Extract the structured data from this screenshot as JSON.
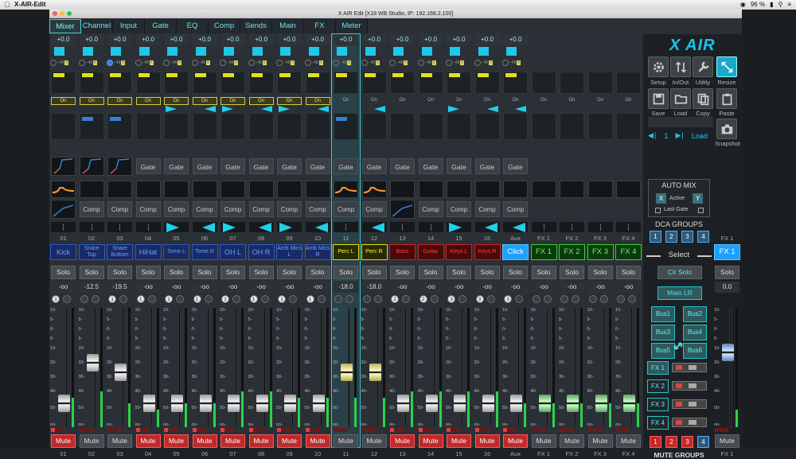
{
  "menubar": {
    "app": "X-AIR-Edit",
    "battery": "96 %"
  },
  "window": {
    "title": "X AIR Edit [X18 WB Studio, IP: 192.168.2.100]"
  },
  "tabs": [
    "Mixer",
    "Channel",
    "Input",
    "Gate",
    "EQ",
    "Comp",
    "Sends",
    "Main",
    "FX",
    "Meter"
  ],
  "strips": [
    {
      "num": "01",
      "name": "Kick",
      "gain": "+0.0",
      "db": "-oo",
      "dca": "1",
      "mute": true,
      "fader": 0.15,
      "level": 0.25,
      "style": "blue1",
      "pan": "",
      "gateOn": true,
      "compOn": true
    },
    {
      "num": "02",
      "name": "Snare Top",
      "gain": "+0.0",
      "db": "-12.5",
      "dca": "",
      "mute": false,
      "fader": 0.55,
      "level": 0.3,
      "style": "",
      "pan": "",
      "gateOn": true,
      "compOn": false
    },
    {
      "num": "03",
      "name": "Snare Bottom",
      "gain": "+0.0",
      "db": "-19.5",
      "dca": "1",
      "mute": false,
      "fader": 0.45,
      "level": 0.2,
      "style": "",
      "pan": "",
      "gateOn": true,
      "compOn": false
    },
    {
      "num": "04",
      "name": "HiHat",
      "gain": "+0.0",
      "db": "-oo",
      "dca": "1",
      "mute": true,
      "fader": 0.15,
      "level": 0.15,
      "style": "blue1",
      "pan": "",
      "gateOn": false,
      "compOn": false
    },
    {
      "num": "05",
      "name": "Tome L",
      "gain": "+0.0",
      "db": "-oo",
      "dca": "1",
      "mute": true,
      "fader": 0.15,
      "level": 0.2,
      "style": "",
      "pan": "r",
      "gateOn": false,
      "compOn": false
    },
    {
      "num": "06",
      "name": "Tome R",
      "gain": "+0.0",
      "db": "-oo",
      "dca": "1",
      "mute": true,
      "fader": 0.15,
      "level": 0.2,
      "style": "",
      "pan": "l",
      "gateOn": false,
      "compOn": false
    },
    {
      "num": "07",
      "name": "OH L",
      "gain": "+0.0",
      "db": "-oo",
      "dca": "1",
      "mute": true,
      "fader": 0.15,
      "level": 0.3,
      "style": "blue1",
      "pan": "r",
      "gateOn": false,
      "compOn": false
    },
    {
      "num": "08",
      "name": "OH R",
      "gain": "+0.0",
      "db": "-oo",
      "dca": "1",
      "mute": true,
      "fader": 0.15,
      "level": 0.3,
      "style": "blue1",
      "pan": "l",
      "gateOn": false,
      "compOn": false
    },
    {
      "num": "09",
      "name": "Amb Mics L",
      "gain": "+0.0",
      "db": "-oo",
      "dca": "1",
      "mute": true,
      "fader": 0.15,
      "level": 0.25,
      "style": "",
      "pan": "r",
      "gateOn": false,
      "compOn": false
    },
    {
      "num": "10",
      "name": "Amb Mics R",
      "gain": "+0.0",
      "db": "-oo",
      "dca": "1",
      "mute": true,
      "fader": 0.15,
      "level": 0.25,
      "style": "",
      "pan": "l",
      "gateOn": false,
      "compOn": false
    },
    {
      "num": "11",
      "name": "Perc L",
      "gain": "+0.0",
      "db": "-18.0",
      "dca": "",
      "mute": false,
      "fader": 0.45,
      "level": 0.25,
      "style": "y",
      "pan": "",
      "gateOn": false,
      "compOn": false,
      "sel": true
    },
    {
      "num": "12",
      "name": "Perc R",
      "gain": "+0.0",
      "db": "-18.0",
      "dca": "",
      "mute": false,
      "fader": 0.45,
      "level": 0.25,
      "style": "y",
      "pan": "l",
      "gateOn": false,
      "compOn": false
    },
    {
      "num": "13",
      "name": "Bass",
      "gain": "+0.0",
      "db": "-oo",
      "dca": "2",
      "mute": true,
      "fader": 0.15,
      "level": 0.3,
      "style": "r",
      "pan": "",
      "gateOn": false,
      "compOn": true
    },
    {
      "num": "14",
      "name": "Guitar",
      "gain": "+0.0",
      "db": "-oo",
      "dca": "2",
      "mute": true,
      "fader": 0.15,
      "level": 0.3,
      "style": "r",
      "pan": "",
      "gateOn": false,
      "compOn": false
    },
    {
      "num": "15",
      "name": "Keys L",
      "gain": "+0.0",
      "db": "-oo",
      "dca": "3",
      "mute": true,
      "fader": 0.15,
      "level": 0.3,
      "style": "r",
      "pan": "r",
      "gateOn": false,
      "compOn": false
    },
    {
      "num": "16",
      "name": "Keys R",
      "gain": "+0.0",
      "db": "-oo",
      "dca": "3",
      "mute": true,
      "fader": 0.15,
      "level": 0.3,
      "style": "r",
      "pan": "l",
      "gateOn": false,
      "compOn": false
    },
    {
      "num": "Aux",
      "name": "Click",
      "gain": "+0.0",
      "db": "-oo",
      "dca": "3",
      "mute": true,
      "fader": 0.15,
      "level": 0.2,
      "style": "cl",
      "pan": "l",
      "gateOn": false,
      "compOn": false
    },
    {
      "num": "FX 1",
      "name": "FX 1",
      "gain": "",
      "db": "-oo",
      "dca": "",
      "mute": false,
      "fader": 0.15,
      "level": 0.2,
      "style": "g",
      "pan": "",
      "gateOn": false,
      "compOn": false
    },
    {
      "num": "FX 2",
      "name": "FX 2",
      "gain": "",
      "db": "-oo",
      "dca": "",
      "mute": false,
      "fader": 0.15,
      "level": 0.2,
      "style": "g",
      "pan": "",
      "gateOn": false,
      "compOn": false
    },
    {
      "num": "FX 3",
      "name": "FX 3",
      "gain": "",
      "db": "-oo",
      "dca": "",
      "mute": false,
      "fader": 0.15,
      "level": 0.2,
      "style": "g",
      "pan": "",
      "gateOn": false,
      "compOn": false
    },
    {
      "num": "FX 4",
      "name": "FX 4",
      "gain": "",
      "db": "-oo",
      "dca": "",
      "mute": false,
      "fader": 0.15,
      "level": 0.2,
      "style": "g",
      "pan": "",
      "gateOn": false,
      "compOn": false
    }
  ],
  "labels": {
    "on": "On",
    "gate": "Gate",
    "comp": "Comp",
    "solo": "Solo",
    "mute": "Mute"
  },
  "scale": [
    "10",
    "5",
    "0",
    "5",
    "10",
    "20",
    "30",
    "40",
    "50",
    "oo"
  ],
  "right": {
    "logo": "X AIR",
    "setup": "Setup",
    "inout": "In/Out",
    "utility": "Utility",
    "resize": "Resize",
    "save": "Save",
    "load": "Load",
    "copy": "Copy",
    "paste": "Paste",
    "snapshot": "Snapshot",
    "snap_num": "1",
    "snap_load": "Load",
    "automix": "AUTO MIX",
    "amx_x": "X",
    "amx_y": "Y",
    "active": "Active",
    "last_gate": "Last Gate",
    "dca_groups": "DCA GROUPS",
    "dca": [
      "1",
      "2",
      "3",
      "4"
    ],
    "select": "Select",
    "clr_solo": "Clr Solo",
    "main_lr": "Main LR",
    "bus": [
      "Bus1",
      "Bus2",
      "Bus3",
      "Bus4",
      "Bus5",
      "Bus6"
    ],
    "fx": [
      "FX 1",
      "FX 2",
      "FX 3",
      "FX 4"
    ],
    "mute_groups": "MUTE GROUPS",
    "mg": [
      "1",
      "2",
      "3",
      "4"
    ]
  },
  "master": {
    "num": "FX 1",
    "name": "FX 1",
    "solo": "Solo",
    "db": "0.0",
    "mute": "Mute",
    "fader": 0.65,
    "level": 0.15
  }
}
